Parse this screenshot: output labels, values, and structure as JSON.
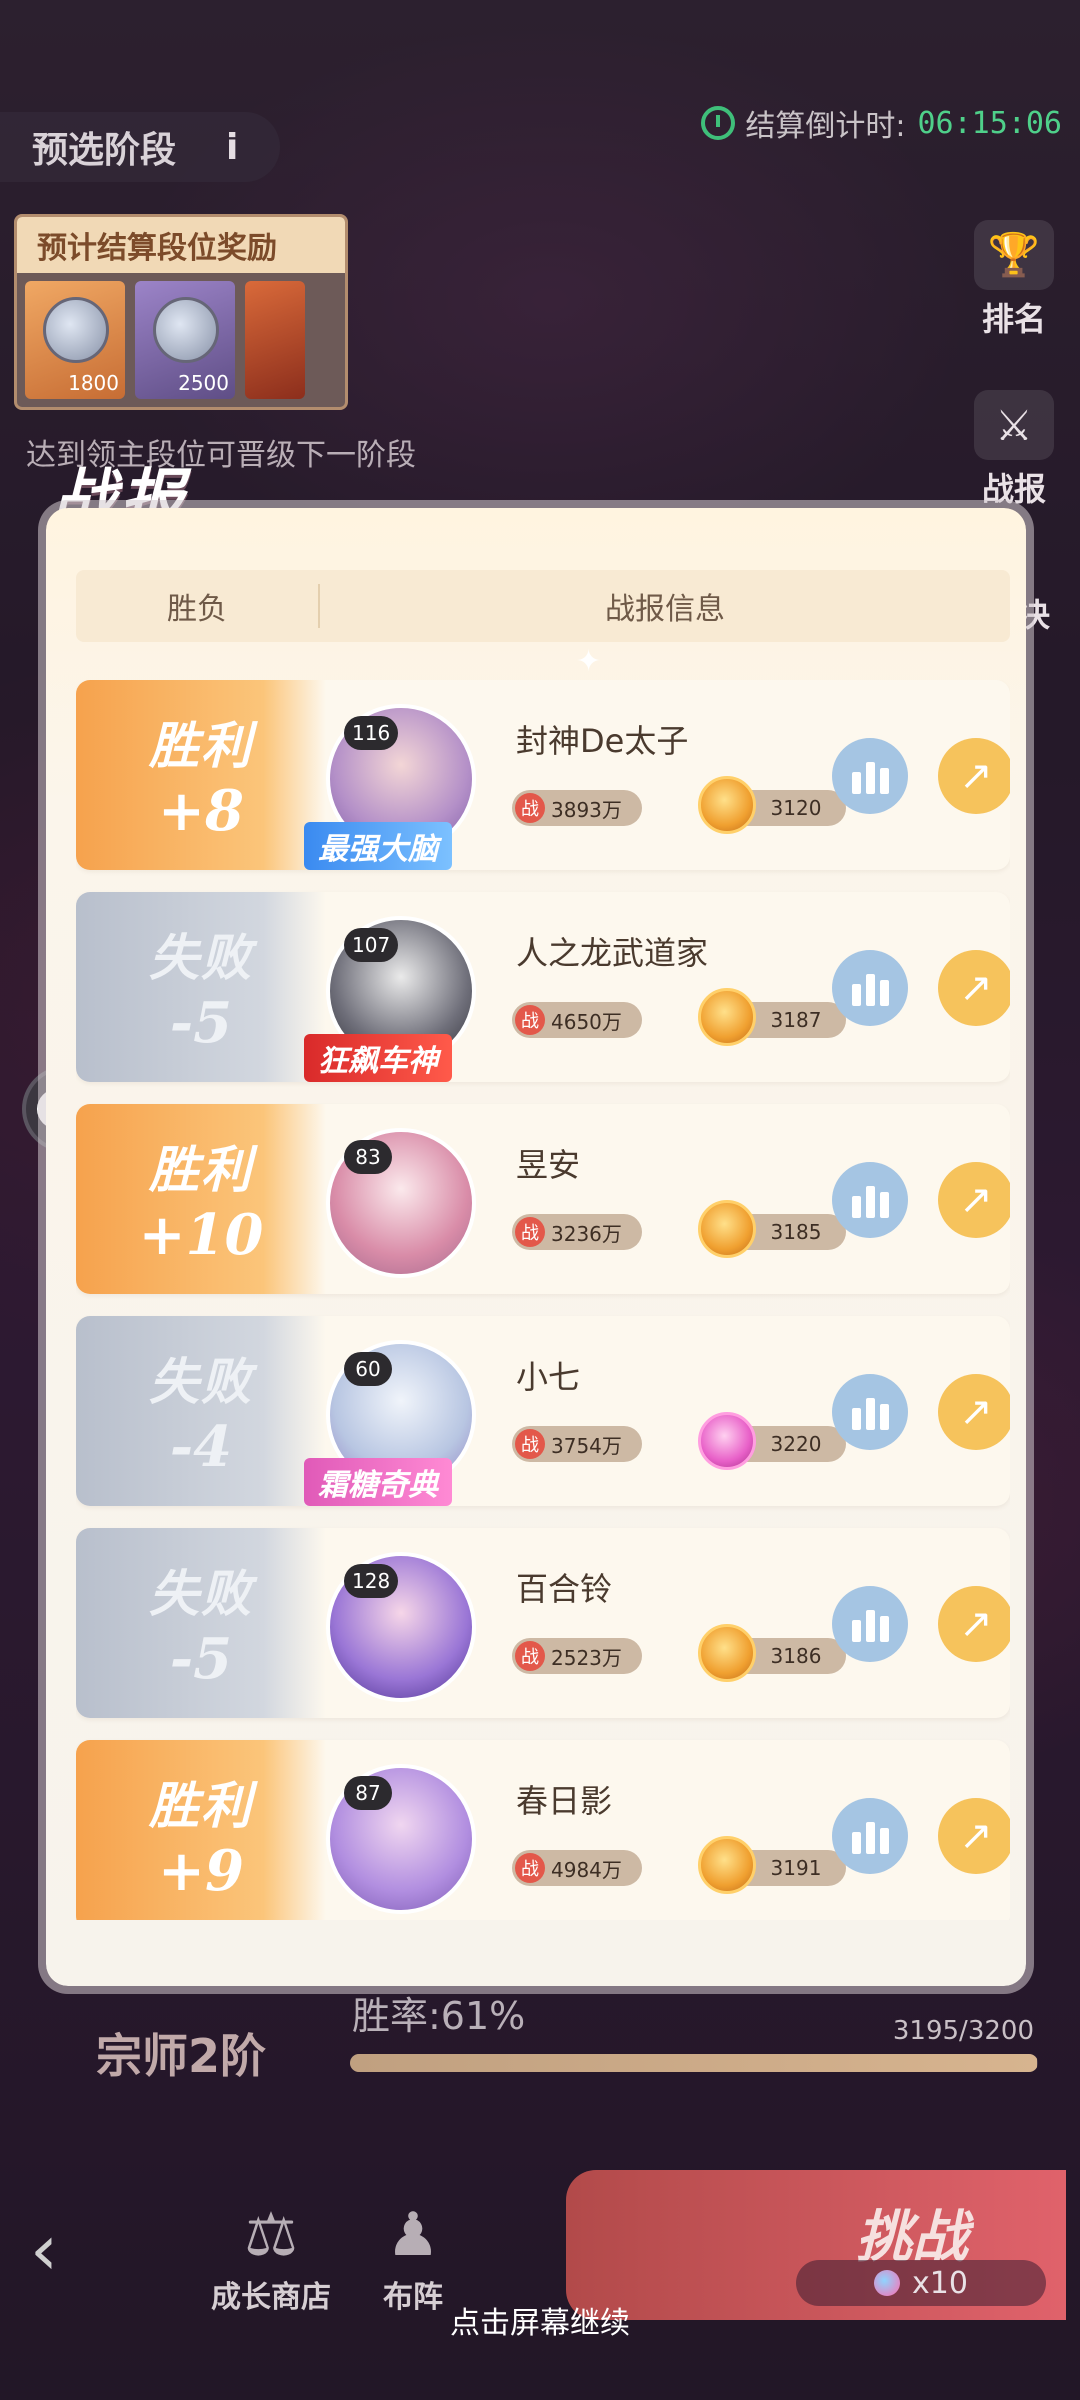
{
  "header": {
    "stage_label": "预选阶段",
    "info_icon": "i",
    "countdown_label": "结算倒计时:",
    "countdown_value": "06:15:06"
  },
  "rewards": {
    "title": "预计结算段位奖励",
    "items": [
      {
        "amount": "1800"
      },
      {
        "amount": "2500"
      },
      {
        "amount": ""
      }
    ],
    "hint": "达到领主段位可晋级下一阶段"
  },
  "side_buttons": {
    "rank": "排名",
    "report": "战报",
    "duel": "决"
  },
  "modal": {
    "title": "战报",
    "col_result": "胜负",
    "col_info": "战报信息",
    "rows": [
      {
        "result": "胜利",
        "score": "+8",
        "level": "116",
        "name": "封神De太子",
        "power": "3893万",
        "rank_points": "3120",
        "tag": "最强大脑"
      },
      {
        "result": "失败",
        "score": "-5",
        "level": "107",
        "name": "人之龙武道家",
        "power": "4650万",
        "rank_points": "3187",
        "tag": "狂飙车神"
      },
      {
        "result": "胜利",
        "score": "+10",
        "level": "83",
        "name": "昱安",
        "power": "3236万",
        "rank_points": "3185",
        "tag": ""
      },
      {
        "result": "失败",
        "score": "-4",
        "level": "60",
        "name": "小七",
        "power": "3754万",
        "rank_points": "3220",
        "tag": "霜糖奇典"
      },
      {
        "result": "失败",
        "score": "-5",
        "level": "128",
        "name": "百合铃",
        "power": "2523万",
        "rank_points": "3186",
        "tag": ""
      },
      {
        "result": "胜利",
        "score": "+9",
        "level": "87",
        "name": "春日影",
        "power": "4984万",
        "rank_points": "3191",
        "tag": ""
      }
    ],
    "power_badge": "战"
  },
  "bottom": {
    "rank_name": "宗师2阶",
    "win_rate": "胜率:61%",
    "progress_text": "3195/3200",
    "progress_fraction": 0.998,
    "shop_label": "成长商店",
    "formation_label": "布阵",
    "challenge_label": "挑战",
    "challenge_cost": "x10",
    "continue_hint": "点击屏幕继续"
  }
}
